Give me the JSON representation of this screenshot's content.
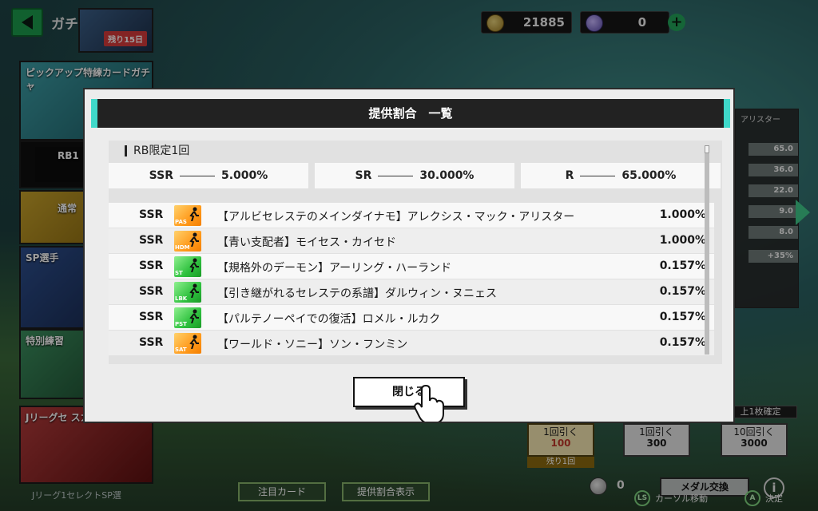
{
  "background": {
    "page_title": "ガチャ",
    "top_banner_badge": "残り15日",
    "currencies": [
      {
        "icon": "coin-gold-icon",
        "value": "21885"
      },
      {
        "icon": "coin-violet-icon",
        "value": "0"
      }
    ],
    "side_cards": {
      "pickup": "ピックアップ特練カードガチャ",
      "rb": "RB1",
      "normal": "通常",
      "sp": "SP選手",
      "train": "特別練習",
      "jleague": "Jリーグセ スカウト"
    },
    "bottom_note": "Jリーグ1セレクトSP選",
    "right_panel": {
      "title": "アリスター",
      "values": [
        "65.0",
        "36.0",
        "22.0",
        "9.0",
        "8.0",
        "+35%"
      ]
    },
    "draws": [
      {
        "label": "1回引く",
        "cost": "100",
        "sub": "残り1回"
      },
      {
        "label": "1回引く",
        "cost": "300"
      },
      {
        "label": "10回引く",
        "cost": "3000"
      }
    ],
    "guarantee": "上1枚確定",
    "buttons": {
      "featured_card": "注目カード",
      "show_rates": "提供割合表示",
      "medal_exchange": "メダル交換"
    },
    "ball_count": "0",
    "hints": [
      {
        "key": "LS",
        "label": "カーソル移動"
      },
      {
        "key": "A",
        "label": "決定"
      }
    ]
  },
  "modal": {
    "title": "提供割合　一覧",
    "section_title": "RB限定1回",
    "rates": [
      {
        "rarity": "SSR",
        "value": "5.000%"
      },
      {
        "rarity": "SR",
        "value": "30.000%"
      },
      {
        "rarity": "R",
        "value": "65.000%"
      }
    ],
    "rows": [
      {
        "rarity": "SSR",
        "position": "PAS",
        "color": "orange",
        "name": "【アルビセレステのメインダイナモ】アレクシス・マック・アリスター",
        "rate": "1.000%"
      },
      {
        "rarity": "SSR",
        "position": "HDM",
        "color": "orange",
        "name": "【青い支配者】モイセス・カイセド",
        "rate": "1.000%"
      },
      {
        "rarity": "SSR",
        "position": "ST",
        "color": "green",
        "name": "【規格外のデーモン】アーリング・ハーランド",
        "rate": "0.157%"
      },
      {
        "rarity": "SSR",
        "position": "LBK",
        "color": "green",
        "name": "【引き継がれるセレステの系譜】ダルウィン・ヌニェス",
        "rate": "0.157%"
      },
      {
        "rarity": "SSR",
        "position": "PST",
        "color": "green",
        "name": "【パルテノーペイでの復活】ロメル・ルカク",
        "rate": "0.157%"
      },
      {
        "rarity": "SSR",
        "position": "SAT",
        "color": "orange",
        "name": "【ワールド・ソニー】ソン・フンミン",
        "rate": "0.157%"
      }
    ],
    "close_label": "閉じる"
  }
}
